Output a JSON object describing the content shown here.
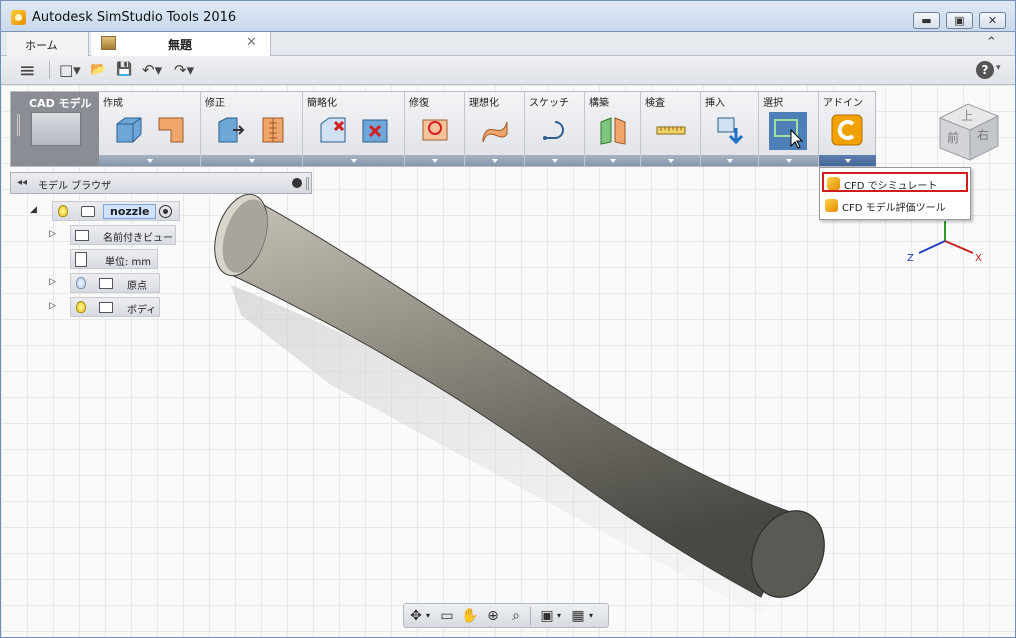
{
  "window": {
    "title": "Autodesk SimStudio Tools 2016",
    "minimize": "▬",
    "maximize": "▣",
    "close": "✕"
  },
  "tabs": {
    "home": "ホーム",
    "doc": "無題",
    "close": "✕"
  },
  "qat": {
    "menu": "≡",
    "new": "□▾",
    "open": "📂",
    "save": "💾",
    "undo": "↶▾",
    "redo": "↷▾",
    "help": "?",
    "help_caret": "▾",
    "collapse": "⌃"
  },
  "ribbon": {
    "workspace": "CAD モデル",
    "panels": [
      "作成",
      "修正",
      "簡略化",
      "修復",
      "理想化",
      "スケッチ",
      "構築",
      "検査",
      "挿入",
      "選択",
      "アドイン"
    ]
  },
  "addin_menu": {
    "items": [
      "CFD でシミュレート",
      "CFD モデル評価ツール"
    ]
  },
  "browser": {
    "title": "モデル ブラウザ",
    "collapse": "◂◂",
    "root": "nozzle",
    "children": [
      "名前付きビュー",
      "単位: mm",
      "原点",
      "ボディ"
    ]
  },
  "viewcube": {
    "top": "上",
    "front": "前",
    "right": "右"
  },
  "triad": {
    "x": "X",
    "z": "Z"
  },
  "colors": {
    "accent": "#466896",
    "highlight": "#d21b1b",
    "addin": "#f0a000"
  }
}
